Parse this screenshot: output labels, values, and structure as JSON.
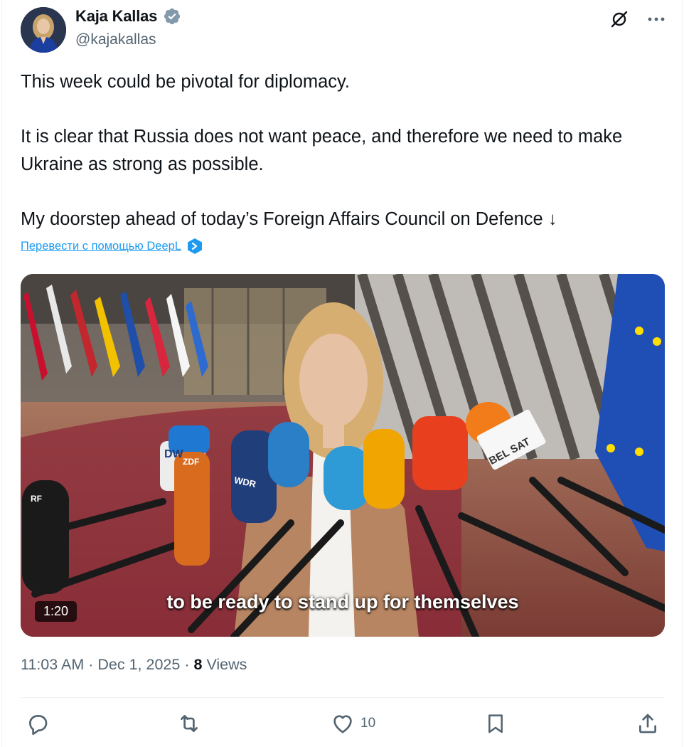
{
  "author": {
    "name": "Kaja Kallas",
    "handle": "@kajakallas",
    "verified_icon": "verified-badge-icon",
    "verified_color": "#829aab"
  },
  "header_actions": {
    "grok_icon": "grok-icon",
    "more_icon": "more-horizontal-icon"
  },
  "tweet": {
    "paragraphs": [
      "This week could be pivotal for diplomacy.",
      "It is clear that Russia does not want peace, and therefore we need to make Ukraine as strong as possible.",
      "My doorstep ahead of today’s Foreign Affairs Council on Defence ↓"
    ],
    "translate_label": "Перевести с помощью DeepL",
    "translate_icon": "deepl-icon"
  },
  "media": {
    "duration": "1:20",
    "caption": "to be ready to stand up for themselves",
    "mic_labels": [
      "DW",
      "ZDF",
      "WDR",
      "BEL SAT",
      "RF"
    ]
  },
  "meta": {
    "time": "11:03 AM",
    "separator": "·",
    "date": "Dec 1, 2025",
    "views_count": "8",
    "views_label": "Views"
  },
  "actions": {
    "reply_icon": "reply-icon",
    "retweet_icon": "retweet-icon",
    "like_icon": "heart-icon",
    "like_count": "10",
    "bookmark_icon": "bookmark-icon",
    "share_icon": "share-icon"
  },
  "colors": {
    "text": "#0f1419",
    "secondary": "#536471",
    "link": "#1d9bf0",
    "divider": "#eff3f4"
  }
}
